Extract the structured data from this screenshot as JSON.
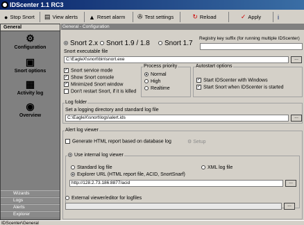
{
  "window": {
    "title": "IDScenter 1.1 RC3"
  },
  "toolbar": {
    "stop_snort": "Stop Snort",
    "view_alerts": "View alerts",
    "reset_alarm": "Reset alarm",
    "test_settings": "Test settings",
    "reload": "Reload",
    "apply": "Apply"
  },
  "sidebar": {
    "header": "General",
    "items": [
      {
        "label": "Configuration",
        "icon": "gears-icon"
      },
      {
        "label": "Snort options",
        "icon": "snort-options-icon"
      },
      {
        "label": "Activity log",
        "icon": "notebook-icon"
      },
      {
        "label": "Overview",
        "icon": "overview-icon"
      }
    ],
    "bottom": [
      "Wizards",
      "Logs",
      "Alerts",
      "Explorer"
    ]
  },
  "main": {
    "title": "General - Configuration",
    "versions": [
      "Snort 2.x",
      "Snort 1.9 / 1.8",
      "Snort 1.7"
    ],
    "selected_version": "Snort 2.x",
    "registry_label": "Registry key suffix (for running multiple IDScenter)",
    "registry_value": "",
    "exe_label": "Snort executable file",
    "exe_value": "C:\\EagleX\\snort\\bin\\snort.exe",
    "checks": [
      {
        "label": "Snort service mode",
        "checked": true
      },
      {
        "label": "Show Snort console",
        "checked": true
      },
      {
        "label": "Minimized Snort window",
        "checked": true
      },
      {
        "label": "Don't restart Snort, if it is killed",
        "checked": false
      }
    ],
    "priority": {
      "label": "Process priority",
      "options": [
        "Normal",
        "High",
        "Realtime"
      ],
      "selected": "Normal"
    },
    "autostart": {
      "label": "Autostart options",
      "options": [
        {
          "label": "Start IDScenter with Windows",
          "checked": true
        },
        {
          "label": "Start Snort when IDScenter is started",
          "checked": true
        }
      ]
    },
    "log_folder": {
      "label": "Log folder",
      "desc": "Set a logging directory and standard log file",
      "value": "C:\\EagleX\\snort\\logs\\alert.ids"
    },
    "alert_viewer": {
      "label": "Alert log viewer",
      "generate_html": "Generate HTML report based on database log",
      "generate_checked": false,
      "setup": "Setup",
      "use_internal": "Use internal log viewer",
      "standard_log": "Standard log file",
      "xml_log": "XML log file",
      "explorer_url": "Explorer URL (HTML report file, ACID, SnortSnarf)",
      "url_value": "http://128.2.73.186:8877/acid",
      "external": "External viewer/editor for logfiles",
      "external_value": ""
    }
  },
  "status": {
    "text": "IDScenter\\General"
  }
}
